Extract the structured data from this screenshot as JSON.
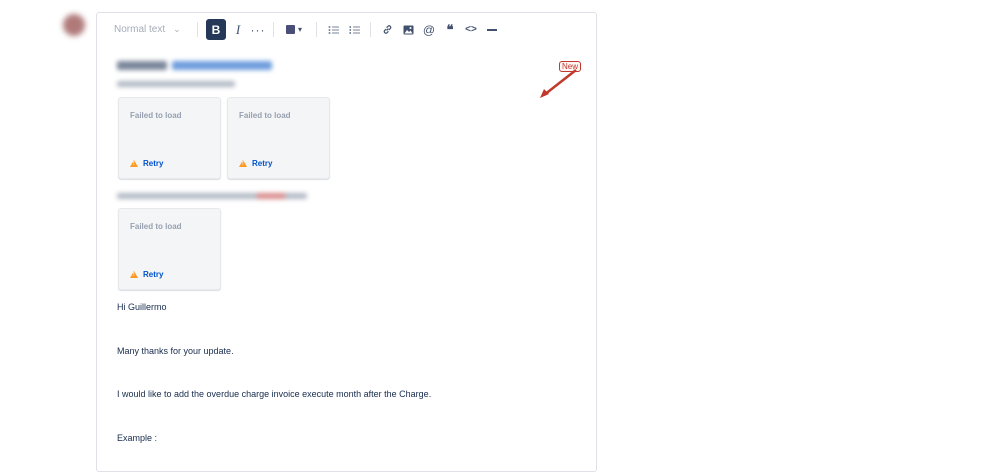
{
  "toolbar": {
    "style_select_label": "Normal text",
    "bold_label": "B",
    "italic_label": "I",
    "more_label": "···"
  },
  "attachments": {
    "failed_text": "Failed to load",
    "retry_label": "Retry"
  },
  "annotation": {
    "badge_label": "New",
    "color": "#c0392b"
  },
  "body": {
    "greeting": "Hi Guillermo",
    "thanks": "Many thanks for your update.",
    "request": "I would like to add the overdue charge invoice execute month after the Charge.",
    "example": "Example :"
  },
  "colors": {
    "accent": "#0052cc",
    "toolbar_active": "#253858",
    "warning": "#ff991f"
  }
}
